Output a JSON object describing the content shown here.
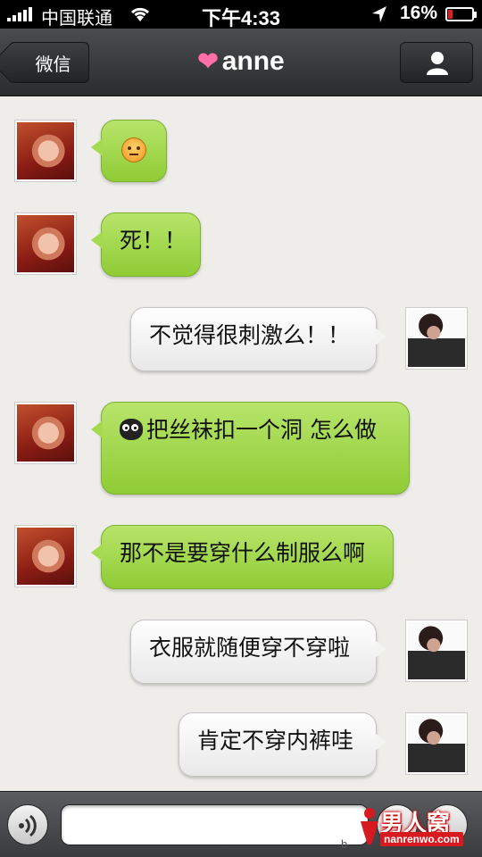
{
  "status_bar": {
    "carrier": "中国联通",
    "time": "下午4:33",
    "battery_percent": "16%",
    "battery_level": 0.16,
    "icons": [
      "signal-icon",
      "wifi-icon",
      "location-icon",
      "battery-icon"
    ]
  },
  "nav": {
    "back_label": "微信",
    "title": "anne",
    "title_icon": "heart-gift-icon",
    "profile_icon": "person-icon"
  },
  "messages": [
    {
      "side": "left",
      "sender": "anne",
      "text": "",
      "icon": "angry-face-emoji-icon"
    },
    {
      "side": "left",
      "sender": "anne",
      "text": "死！！"
    },
    {
      "side": "right",
      "sender": "me",
      "text": "不觉得很刺激么！！"
    },
    {
      "side": "left",
      "sender": "anne",
      "text": "把丝袜扣一个洞 怎么做",
      "icon": "owl-emoji-icon"
    },
    {
      "side": "left",
      "sender": "anne",
      "text": "那不是要穿什么制服么啊"
    },
    {
      "side": "right",
      "sender": "me",
      "text": "衣服就随便穿不穿啦"
    },
    {
      "side": "right",
      "sender": "me",
      "text": "肯定不穿内裤哇"
    }
  ],
  "input_bar": {
    "text_value": "",
    "voice_icon": "voice-icon"
  },
  "watermark": {
    "name": "男人窝",
    "url": "nanrenwo.com",
    "prefix": "b"
  },
  "colors": {
    "green_bubble": "#9fd34a",
    "white_bubble": "#f4f4f4",
    "nav_bar": "#3a3b3d"
  }
}
